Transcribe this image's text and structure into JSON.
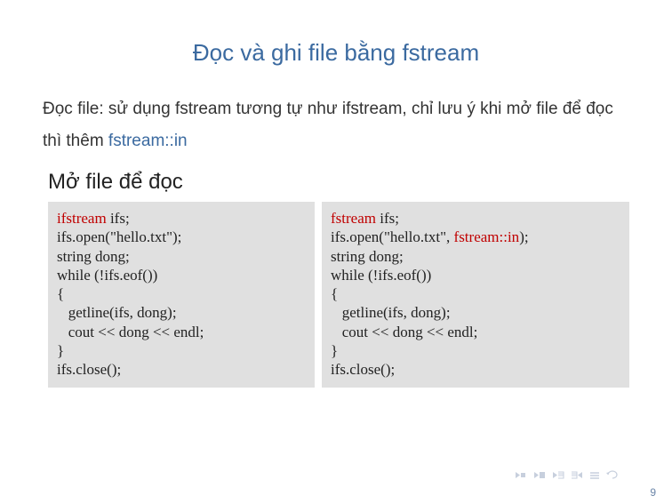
{
  "title": "Đọc và ghi file bằng fstream",
  "body_part1": "Đọc file: sử dụng fstream tương tự như ifstream, chỉ lưu ý khi mở file để đọc thì thêm ",
  "body_hl": "fstream::in",
  "subtitle": "Mở file để đọc",
  "code_left": {
    "l1a": "ifstream",
    "l1b": " ifs;",
    "l2": "ifs.open(\"hello.txt\");",
    "l3": "string dong;",
    "l4": "while (!ifs.eof())",
    "l5": "{",
    "l6": "   getline(ifs, dong);",
    "l7": "   cout << dong << endl;",
    "l8": "}",
    "l9": "ifs.close();"
  },
  "code_right": {
    "l1a": "fstream",
    "l1b": " ifs;",
    "l2a": "ifs.open(\"hello.txt\", ",
    "l2b": "fstream::in",
    "l2c": ");",
    "l3": "string dong;",
    "l4": "while (!ifs.eof())",
    "l5": "{",
    "l6": "   getline(ifs, dong);",
    "l7": "   cout << dong << endl;",
    "l8": "}",
    "l9": "ifs.close();"
  },
  "page_number": "9"
}
